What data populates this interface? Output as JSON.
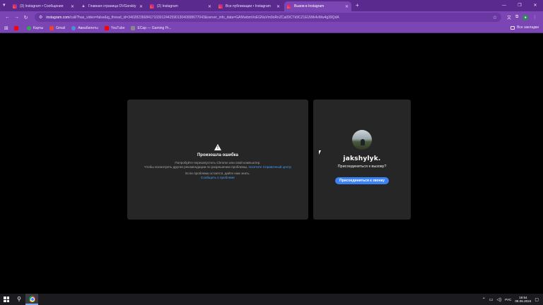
{
  "tabs": [
    {
      "title": "(3) Instagram • Сообщения",
      "favicon": "instagram-icon",
      "active": false
    },
    {
      "title": "Главная страница OVGorskiy",
      "favicon": "drive-icon",
      "active": false
    },
    {
      "title": "(2) Instagram",
      "favicon": "instagram-icon",
      "active": false
    },
    {
      "title": "Все публикации • Instagram",
      "favicon": "instagram-icon",
      "active": false
    },
    {
      "title": "Вызов в Instagram",
      "favicon": "instagram-icon",
      "active": true
    }
  ],
  "omnibox": {
    "host": "instagram.com",
    "path": "/call/?has_video=false&ig_thread_id=340282366841710301244259013040008677043&server_info_data=GAN\\wbmVoEGNuVm9oRnZCa09CTk9CZ1EUWk4vMw4g39QdA"
  },
  "bookmarks": {
    "items": [
      {
        "label": "",
        "icon": "youtube-icon",
        "color": "#ff0000"
      },
      {
        "label": "Карты",
        "icon": "maps-icon",
        "color": "#34a853"
      },
      {
        "label": "Gmail",
        "icon": "gmail-icon",
        "color": "#ea4335"
      },
      {
        "label": "Авиабилеты",
        "icon": "flights-icon",
        "color": "#4a90e2"
      },
      {
        "label": "YouTube",
        "icon": "youtube-icon",
        "color": "#ff0000"
      },
      {
        "label": "ECap — Gaming Pr...",
        "icon": "ecap-icon",
        "color": "#888888"
      }
    ],
    "all_label": "Все закладки"
  },
  "error_card": {
    "title": "Произошла ошибка",
    "line1": "Попробуйте перезапустить Chrome или свой компьютер.",
    "line2_prefix": "Чтобы посмотреть другие рекомендации по разрешению проблемы, ",
    "line2_link": "посетите Справочный центр",
    "line3": "Если проблема остается, дайте нам знать.",
    "report_link": "Сообщить о проблеме"
  },
  "call_card": {
    "username": "jakshylyk.",
    "question": "Присоединиться к вызову?",
    "join_label": "Присоединиться к звонку"
  },
  "taskbar": {
    "lang": "РУС",
    "time": "18:54",
    "date": "08.06.2024"
  }
}
